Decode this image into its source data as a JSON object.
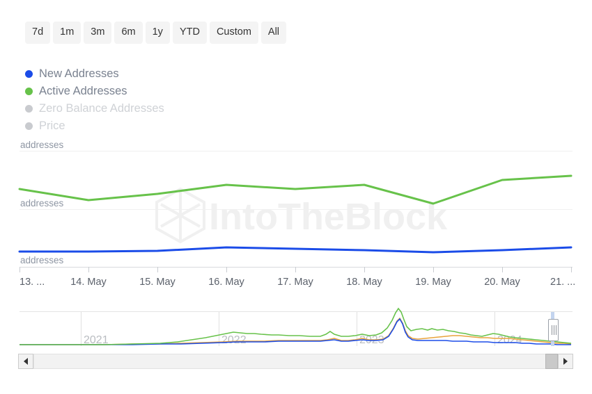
{
  "range_selector": {
    "buttons": [
      {
        "label": "7d"
      },
      {
        "label": "1m"
      },
      {
        "label": "3m"
      },
      {
        "label": "6m"
      },
      {
        "label": "1y"
      },
      {
        "label": "YTD"
      },
      {
        "label": "Custom"
      },
      {
        "label": "All"
      }
    ]
  },
  "legend": {
    "items": [
      {
        "label": "New Addresses",
        "color": "#1b4ce8",
        "active": true
      },
      {
        "label": "Active Addresses",
        "color": "#67c24a",
        "active": true
      },
      {
        "label": "Zero Balance Addresses",
        "color": "#c9cbcf",
        "active": false
      },
      {
        "label": "Price",
        "color": "#c9cbcf",
        "active": false
      }
    ]
  },
  "watermark": {
    "text": "IntoTheBlock",
    "logo_icon": "intotheblock-hexagon-logo"
  },
  "chart_data": {
    "type": "line",
    "title": "",
    "xlabel": "",
    "ylabel": "addresses",
    "grid": true,
    "legend_position": "top-left",
    "x": [
      "13. ...",
      "14. May",
      "15. May",
      "16. May",
      "17. May",
      "18. May",
      "19. May",
      "20. May",
      "21. ..."
    ],
    "y_tick_labels": [
      "addresses",
      "addresses",
      "addresses"
    ],
    "series": [
      {
        "name": "New Addresses",
        "color": "#1b4ce8",
        "values": [
          362,
          362,
          361,
          356,
          358,
          360,
          363,
          360,
          356
        ]
      },
      {
        "name": "Active Addresses",
        "color": "#67c24a",
        "values": [
          272,
          288,
          279,
          266,
          272,
          266,
          293,
          259,
          253
        ]
      }
    ],
    "navigator": {
      "year_labels": [
        "2021",
        "2022",
        "2023",
        "2024"
      ],
      "series": [
        {
          "name": "Active Addresses",
          "color": "#67c24a"
        },
        {
          "name": "New Addresses",
          "color": "#1b4ce8"
        },
        {
          "name": "Price",
          "color": "#e8a33d"
        }
      ]
    }
  },
  "navigator_controls": {
    "scroll_left_icon": "arrow-left-icon",
    "scroll_right_icon": "arrow-right-icon",
    "right_handle_icon": "resize-grip-icon"
  }
}
